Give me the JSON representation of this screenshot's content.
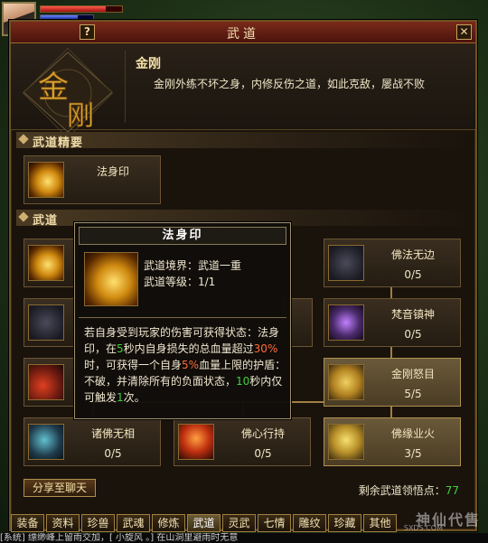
{
  "window": {
    "title": "武道",
    "help": "?",
    "close": "✕"
  },
  "hud": {
    "paw": "✿"
  },
  "header": {
    "emblem_text": "金刚",
    "name": "金刚",
    "desc": "金刚外练不坏之身，内修反伤之道，如此克敌，屡战不败"
  },
  "sections": {
    "essence": "武道精要",
    "wudao": "武道"
  },
  "essence_card": {
    "name": "法身印"
  },
  "skills": [
    {
      "name": "佛法无边",
      "count": "0/5"
    },
    {
      "name": "梵音镇神",
      "count": "0/5"
    },
    {
      "name": "金刚怒目",
      "count": "5/5"
    },
    {
      "name": "诸佛无相",
      "count": "0/5"
    },
    {
      "name": "佛心行持",
      "count": "0/5"
    },
    {
      "name": "佛缘业火",
      "count": "3/5"
    }
  ],
  "tooltip": {
    "title": "法身印",
    "realm": "武道境界：武道一重",
    "level": "武道等级：1/1",
    "desc_1": "若自身受到玩家的伤害可获得状态：法身印，在",
    "desc_n1": "5",
    "desc_2": "秒内自身损失的总血量超过",
    "desc_n2": "30%",
    "desc_3": "时，可获得一个自身",
    "desc_n3": "5%",
    "desc_4": "血量上限的护盾：不破，并清除所有的负面状态，",
    "desc_n4": "10",
    "desc_5": "秒内仅可触发",
    "desc_n5": "1",
    "desc_6": "次。"
  },
  "footer": {
    "share": "分享至聊天",
    "remain_label": "剩余武道领悟点：",
    "remain_value": "77"
  },
  "tabs": [
    "装备",
    "资料",
    "珍兽",
    "武魂",
    "修炼",
    "武道",
    "灵武",
    "七情",
    "雕纹",
    "珍藏",
    "其他"
  ],
  "active_tab": "武道",
  "chat": {
    "line": "[系统] 缥缈峰上留雨交加，[ 小旋风 。] 在山洞里避雨时无意"
  },
  "watermark": {
    "main": "神仙代售",
    "sub": "SXDS.COM"
  },
  "colors": {
    "accent_green": "#40d040",
    "accent_red": "#ff6a3a",
    "border_gold": "#a08040"
  }
}
